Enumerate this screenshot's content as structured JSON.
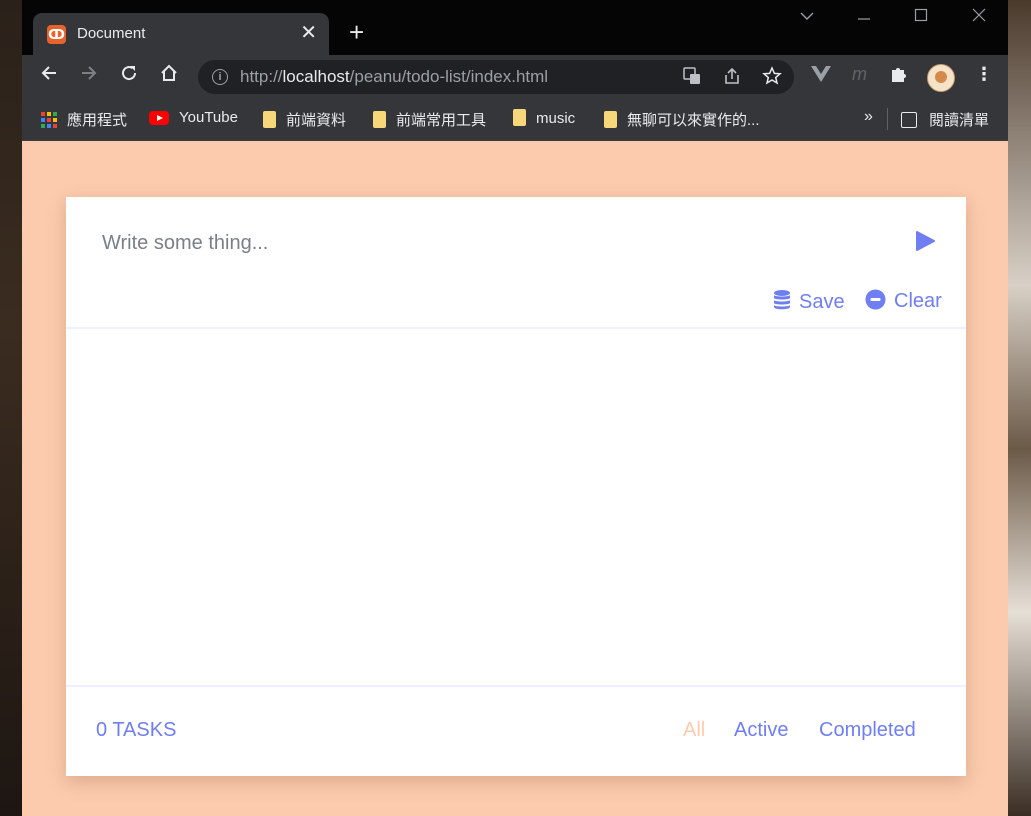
{
  "browser": {
    "tab": {
      "title": "Document",
      "favicon": "xampp-icon",
      "favicon_color": "#e8622c"
    },
    "new_tab_label": "+",
    "window_controls": [
      "tab-search",
      "minimize",
      "maximize",
      "close"
    ],
    "url": {
      "scheme": "http://",
      "host": "localhost",
      "path": "/peanu/todo-list/index.html"
    },
    "bookmarks": [
      {
        "label": "應用程式",
        "icon": "apps-grid-icon"
      },
      {
        "label": "YouTube",
        "icon": "youtube-icon"
      },
      {
        "label": "前端資料",
        "icon": "folder-icon"
      },
      {
        "label": "前端常用工具",
        "icon": "folder-icon"
      },
      {
        "label": "music",
        "icon": "folder-icon"
      },
      {
        "label": "無聊可以來實作的...",
        "icon": "folder-icon"
      }
    ],
    "bookmarks_more": "»",
    "reading_list": "閱讀清單"
  },
  "todo": {
    "input_placeholder": "Write some thing...",
    "input_value": "",
    "save_label": "Save",
    "clear_label": "Clear",
    "count_label": "0 TASKS",
    "filters": [
      {
        "label": "All",
        "active": true
      },
      {
        "label": "Active",
        "active": false
      },
      {
        "label": "Completed",
        "active": false
      }
    ],
    "tasks": []
  },
  "colors": {
    "page_background": "#fccbad",
    "accent": "#6f7ef0",
    "card": "#ffffff",
    "filter_active": "#fccbad"
  }
}
